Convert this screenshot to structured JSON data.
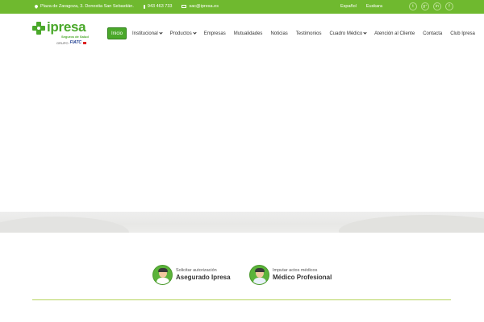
{
  "topbar": {
    "address": "Plaza de Zaragoza, 3. Donostia San Sebastián.",
    "phone": "943 463 733",
    "email": "sac@ipresa.es",
    "languages": [
      "Español",
      "Euskara"
    ],
    "social_icons": [
      "twitter-icon",
      "google-plus-icon",
      "linkedin-icon",
      "facebook-icon"
    ],
    "social_glyphs": [
      "t",
      "g⁺",
      "in",
      "f"
    ]
  },
  "logo": {
    "name": "ipresa",
    "tagline": "Seguros de Salud",
    "group_prefix": "GRUPO",
    "group_name": "FIATC"
  },
  "nav": {
    "items": [
      {
        "label": "Inicio",
        "active": true,
        "dropdown": false
      },
      {
        "label": "Institucional",
        "active": false,
        "dropdown": true
      },
      {
        "label": "Productos",
        "active": false,
        "dropdown": true
      },
      {
        "label": "Empresas",
        "active": false,
        "dropdown": false
      },
      {
        "label": "Mutualidades",
        "active": false,
        "dropdown": false
      },
      {
        "label": "Noticias",
        "active": false,
        "dropdown": false
      },
      {
        "label": "Testimonios",
        "active": false,
        "dropdown": false
      },
      {
        "label": "Cuadro Médico",
        "active": false,
        "dropdown": true
      },
      {
        "label": "Atención al Cliente",
        "active": false,
        "dropdown": false
      },
      {
        "label": "Contacta",
        "active": false,
        "dropdown": false
      },
      {
        "label": "Club Ipresa",
        "active": false,
        "dropdown": false
      }
    ]
  },
  "access": {
    "insured": {
      "small": "Solicitar autorización",
      "big": "Asegurado Ipresa"
    },
    "doctor": {
      "small": "Imputar actos médicos",
      "big": "Médico Profesional"
    }
  },
  "colors": {
    "brand_green": "#6fb92f",
    "logo_green": "#4aa82a",
    "divider": "#b6d45c"
  }
}
